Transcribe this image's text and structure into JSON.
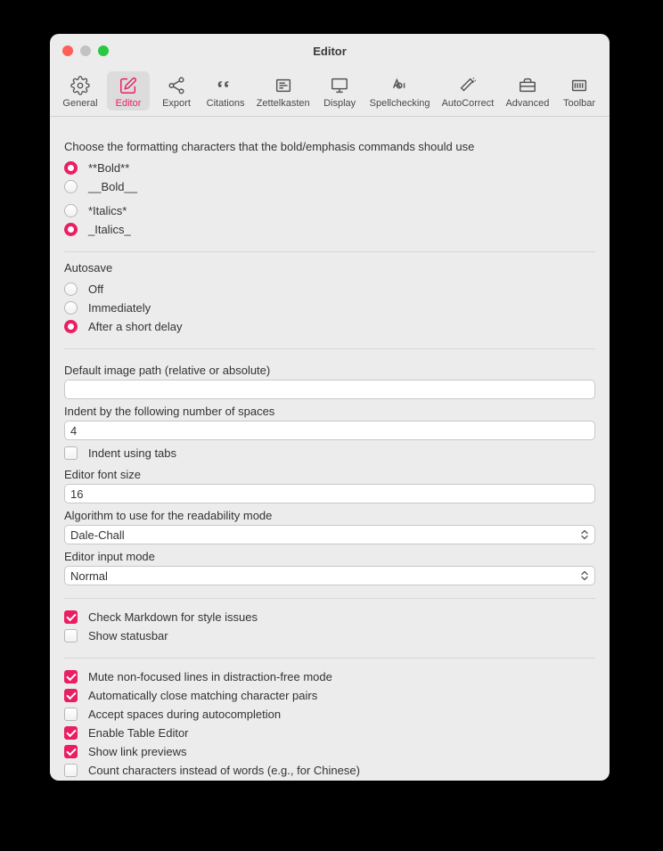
{
  "window": {
    "title": "Editor"
  },
  "toolbar": {
    "items": [
      {
        "label": "General"
      },
      {
        "label": "Editor"
      },
      {
        "label": "Export"
      },
      {
        "label": "Citations"
      },
      {
        "label": "Zettelkasten"
      },
      {
        "label": "Display"
      },
      {
        "label": "Spellchecking"
      },
      {
        "label": "AutoCorrect"
      },
      {
        "label": "Advanced"
      },
      {
        "label": "Toolbar"
      }
    ],
    "activeIndex": 1
  },
  "formatting": {
    "prompt": "Choose the formatting characters that the bold/emphasis commands should use",
    "bold1": "**Bold**",
    "bold2": "__Bold__",
    "ital1": "*Italics*",
    "ital2": "_Italics_"
  },
  "autosave": {
    "heading": "Autosave",
    "off": "Off",
    "immediate": "Immediately",
    "delay": "After a short delay"
  },
  "fields": {
    "img_label": "Default image path (relative or absolute)",
    "img_value": "",
    "indent_label": "Indent by the following number of spaces",
    "indent_value": "4",
    "indent_tabs": "Indent using tabs",
    "fontsize_label": "Editor font size",
    "fontsize_value": "16",
    "readability_label": "Algorithm to use for the readability mode",
    "readability_value": "Dale-Chall",
    "inputmode_label": "Editor input mode",
    "inputmode_value": "Normal"
  },
  "checks1": {
    "lint_md": "Check Markdown for style issues",
    "status": "Show statusbar"
  },
  "checks2": {
    "mute": "Mute non-focused lines in distraction-free mode",
    "autoclose": "Automatically close matching character pairs",
    "spaces_ac": "Accept spaces during autocompletion",
    "table_editor": "Enable Table Editor",
    "link_preview": "Show link previews",
    "count_chars": "Count characters instead of words (e.g., for Chinese)"
  }
}
